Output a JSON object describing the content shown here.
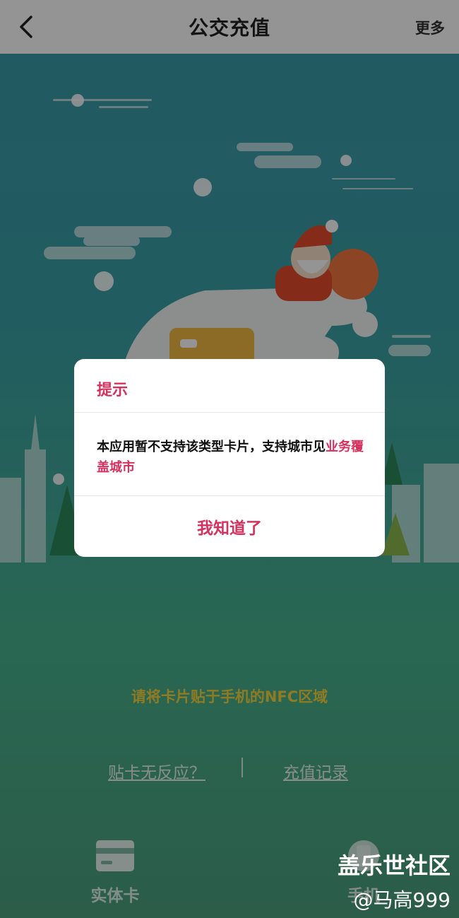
{
  "header": {
    "title": "公交充值",
    "more_label": "更多"
  },
  "main": {
    "nfc_hint": "请将卡片贴于手机的NFC区域",
    "link_no_response": "贴卡无反应？",
    "link_records": "充值记录"
  },
  "tabs": [
    {
      "label": "实体卡"
    },
    {
      "label": "手机"
    }
  ],
  "dialog": {
    "title": "提示",
    "message_prefix": "本应用暂不支持该类型卡片，支持城市见",
    "message_link": "业务覆盖城市",
    "button_label": "我知道了"
  },
  "watermark": {
    "line1": "盖乐世社区",
    "line2": "@马高999"
  },
  "colors": {
    "accent": "#d6305e",
    "header_bg": "#ffffff",
    "hint": "#f4d43e"
  }
}
